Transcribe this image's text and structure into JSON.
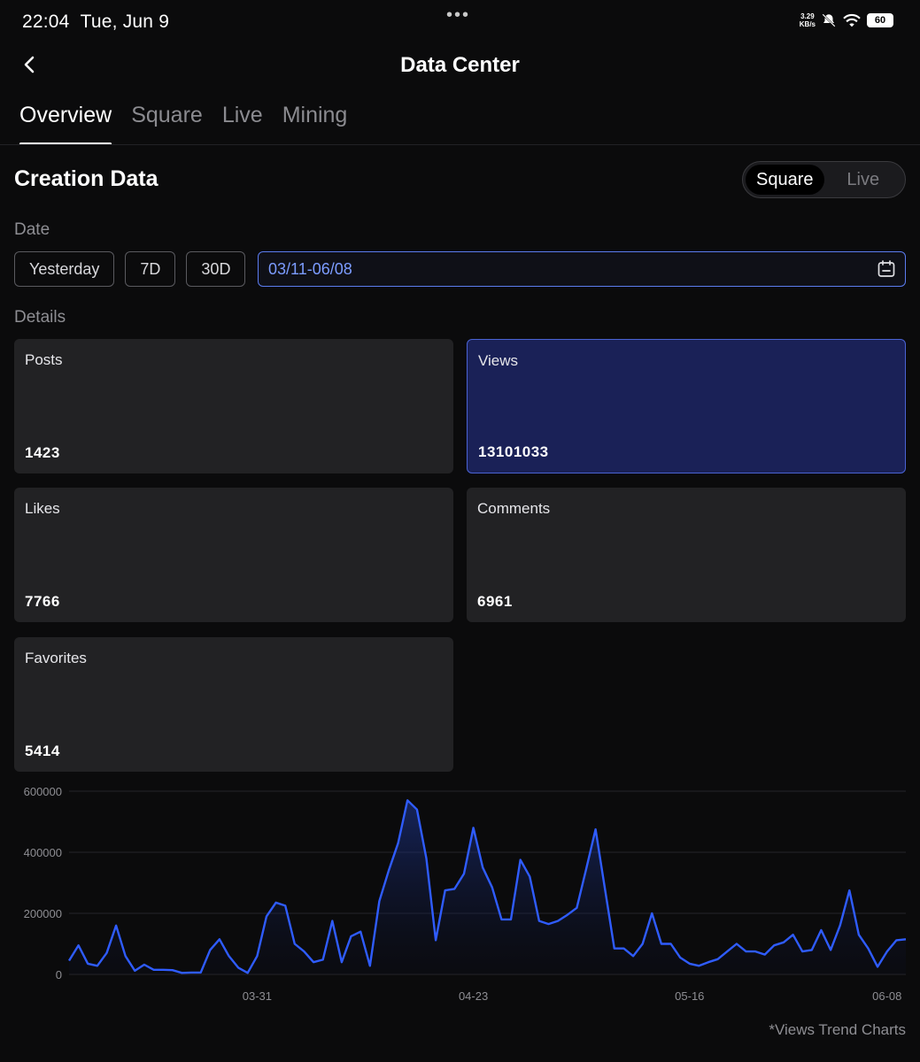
{
  "status_bar": {
    "time": "22:04",
    "date": "Tue, Jun 9",
    "net_speed_value": "3.29",
    "net_speed_unit": "KB/s",
    "battery": "60",
    "icons": [
      "notifications-off-icon",
      "wifi-icon",
      "battery-icon"
    ]
  },
  "header": {
    "title": "Data Center",
    "back_icon": "chevron-left-icon"
  },
  "tabs": [
    {
      "label": "Overview",
      "active": true
    },
    {
      "label": "Square",
      "active": false
    },
    {
      "label": "Live",
      "active": false
    },
    {
      "label": "Mining",
      "active": false
    }
  ],
  "creation": {
    "title": "Creation Data",
    "toggle": [
      {
        "label": "Square",
        "active": true
      },
      {
        "label": "Live",
        "active": false
      }
    ]
  },
  "date": {
    "label": "Date",
    "chips": [
      "Yesterday",
      "7D",
      "30D"
    ],
    "range_value": "03/11-06/08",
    "calendar_icon": "calendar-icon",
    "accent": "#5b7cf0"
  },
  "details": {
    "label": "Details",
    "cards": [
      {
        "label": "Posts",
        "value": "1423",
        "selected": false
      },
      {
        "label": "Views",
        "value": "13101033",
        "selected": true
      },
      {
        "label": "Likes",
        "value": "7766",
        "selected": false
      },
      {
        "label": "Comments",
        "value": "6961",
        "selected": false
      },
      {
        "label": "Favorites",
        "value": "5414",
        "selected": false
      }
    ]
  },
  "chart_note": "*Views Trend Charts",
  "chart_data": {
    "type": "area",
    "line_color": "#2f5cff",
    "grid": true,
    "ylim": [
      0,
      600000
    ],
    "y_ticks": [
      "600000",
      "400000",
      "200000",
      "0"
    ],
    "x_ticks": [
      "03-31",
      "04-23",
      "05-16",
      "06-08"
    ],
    "x_tick_index": [
      20,
      43,
      66,
      87
    ],
    "series": [
      {
        "values": [
          45000,
          95000,
          35000,
          28000,
          70000,
          160000,
          60000,
          12000,
          32000,
          15000,
          15000,
          14000,
          5000,
          6000,
          6000,
          80000,
          115000,
          60000,
          22000,
          5000,
          60000,
          190000,
          235000,
          225000,
          100000,
          75000,
          40000,
          48000,
          175000,
          40000,
          125000,
          140000,
          28000,
          240000,
          340000,
          430000,
          570000,
          540000,
          380000,
          112000,
          275000,
          280000,
          330000,
          480000,
          350000,
          285000,
          180000,
          180000,
          375000,
          320000,
          175000,
          165000,
          175000,
          195000,
          218000,
          345000,
          475000,
          280000,
          85000,
          85000,
          60000,
          100000,
          200000,
          100000,
          100000,
          55000,
          35000,
          28000,
          40000,
          50000,
          75000,
          100000,
          75000,
          75000,
          65000,
          95000,
          105000,
          130000,
          75000,
          80000,
          145000,
          80000,
          160000,
          275000,
          130000,
          85000,
          25000,
          75000,
          112000,
          115000
        ]
      }
    ]
  }
}
